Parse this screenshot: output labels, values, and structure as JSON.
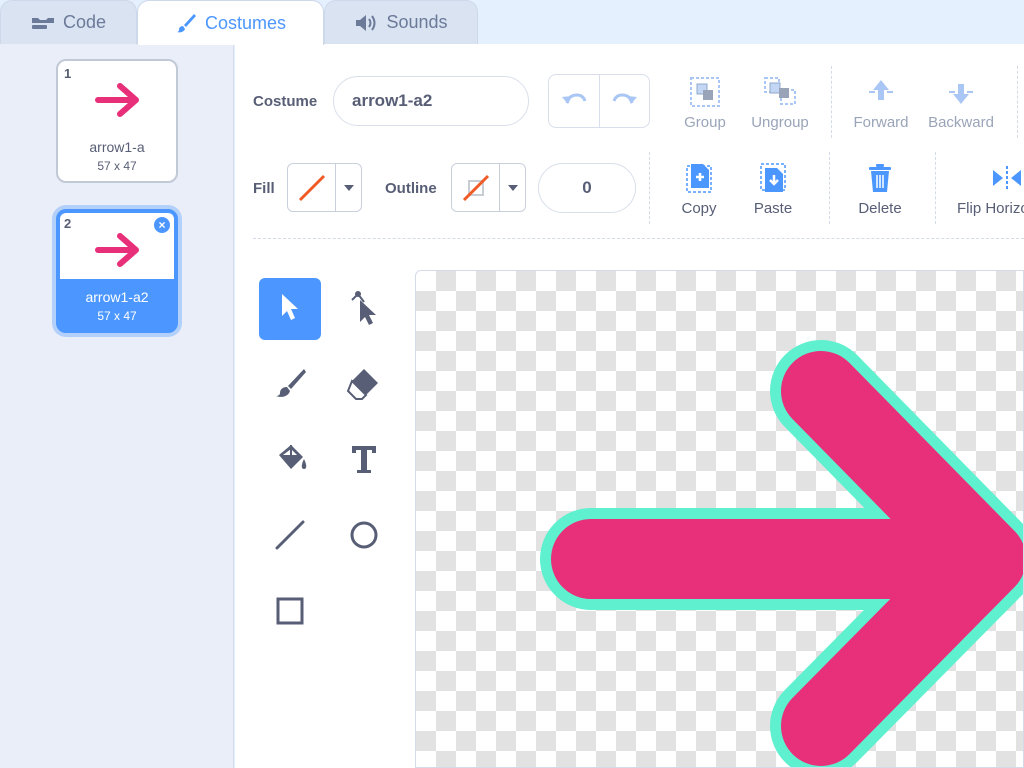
{
  "tabs": [
    {
      "label": "Code",
      "icon": "code-icon",
      "active": false
    },
    {
      "label": "Costumes",
      "icon": "paintbrush-icon",
      "active": true
    },
    {
      "label": "Sounds",
      "icon": "speaker-icon",
      "active": false
    }
  ],
  "costumes": [
    {
      "number": "1",
      "name": "arrow1-a",
      "size": "57 x 47",
      "selected": false
    },
    {
      "number": "2",
      "name": "arrow1-a2",
      "size": "57 x 47",
      "selected": true
    }
  ],
  "toolbar": {
    "costume_label": "Costume",
    "costume_name": "arrow1-a2",
    "group_label": "Group",
    "ungroup_label": "Ungroup",
    "forward_label": "Forward",
    "backward_label": "Backward",
    "fill_label": "Fill",
    "outline_label": "Outline",
    "outline_width": "0",
    "copy_label": "Copy",
    "paste_label": "Paste",
    "delete_label": "Delete",
    "flip_label": "Flip Horizo"
  },
  "tools": [
    "select-tool",
    "reshape-tool",
    "brush-tool",
    "eraser-tool",
    "fill-tool",
    "text-tool",
    "line-tool",
    "circle-tool",
    "rectangle-tool"
  ],
  "colors": {
    "accent": "#4c97ff",
    "arrow_fill": "#e8307a",
    "arrow_outline": "#5ff0cf",
    "text": "#575e75"
  }
}
